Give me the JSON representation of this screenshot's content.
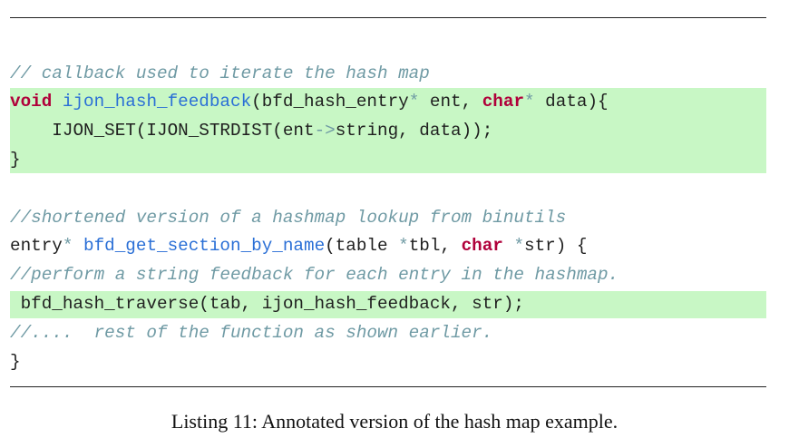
{
  "listing": {
    "line1": {
      "comment": "// callback used to iterate the hash map"
    },
    "line2": {
      "kw_void": "void",
      "fn_name": "ijon_hash_feedback",
      "params_a": "(bfd_hash_entry",
      "star1": "*",
      "params_b": " ent, ",
      "kw_char": "char",
      "star2": "*",
      "params_c": " data){"
    },
    "line3": {
      "indent": "    ",
      "code_a": "IJON_SET(IJON_STRDIST(ent",
      "arrow": "->",
      "code_b": "string, data));"
    },
    "line4": {
      "brace": "}"
    },
    "line5": {
      "comment": "//shortened version of a hashmap lookup from binutils"
    },
    "line6": {
      "type": "entry",
      "star1": "*",
      "space": " ",
      "fn_name": "bfd_get_section_by_name",
      "params_a": "(table ",
      "star2": "*",
      "params_b": "tbl, ",
      "kw_char": "char",
      "space2": " ",
      "star3": "*",
      "params_c": "str) {"
    },
    "line7": {
      "comment": "//perform a string feedback for each entry in the hashmap."
    },
    "line8": {
      "code": " bfd_hash_traverse(tab, ijon_hash_feedback, str);"
    },
    "line9": {
      "comment": "//....  rest of the function as shown earlier."
    },
    "line10": {
      "brace": "}"
    }
  },
  "caption": "Listing 11: Annotated version of the hash map example."
}
